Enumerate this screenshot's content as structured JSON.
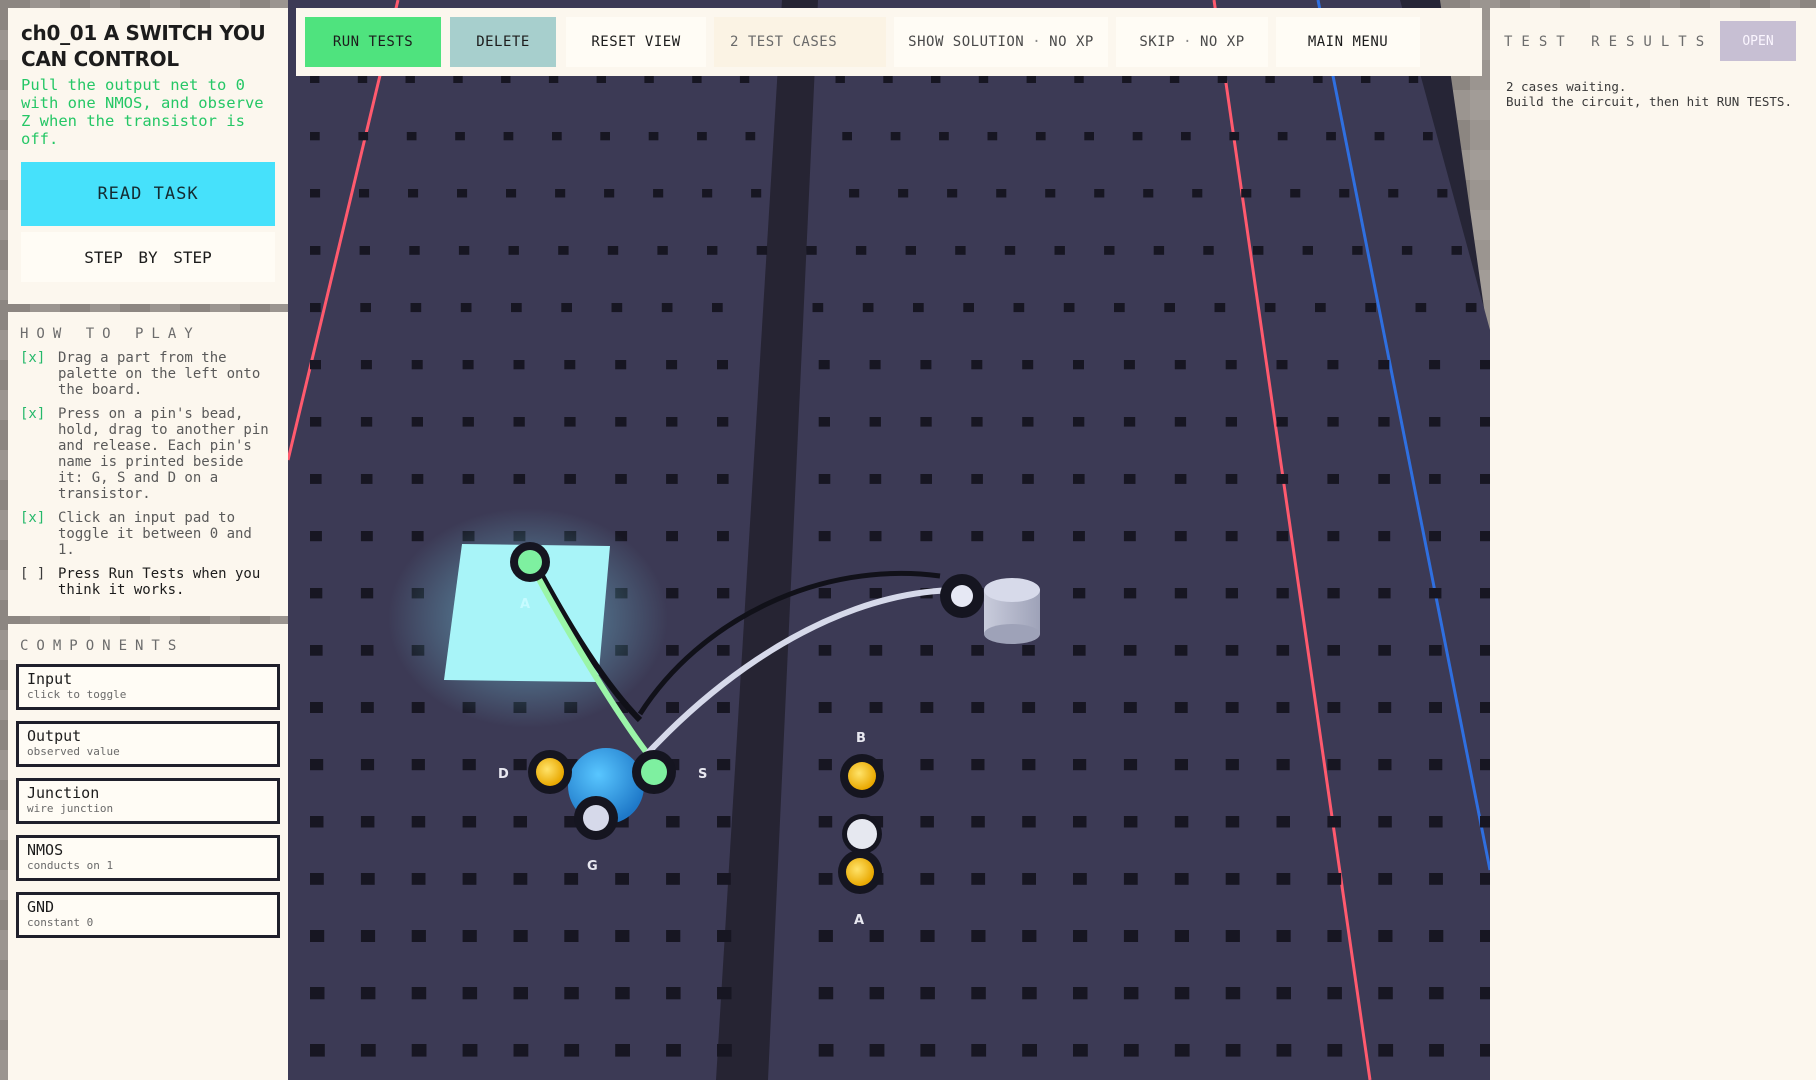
{
  "task": {
    "title": "ch0_01  A SWITCH YOU CAN CONTROL",
    "description": "Pull the output net to 0 with one NMOS, and observe Z when the transistor is off.",
    "read_task_label": "READ TASK",
    "step_by_step_label": "STEP  BY  STEP"
  },
  "how_to_play": {
    "title": "HOW TO PLAY",
    "items": [
      {
        "box": "[x]",
        "text": "Drag a part from the palette on the left onto the board."
      },
      {
        "box": "[x]",
        "text": "Press on a pin's bead, hold, drag to another pin and release. Each pin's name is printed beside it: G, S and D on a transistor."
      },
      {
        "box": "[x]",
        "text": "Click an input pad to toggle it between 0 and 1."
      },
      {
        "box": "[ ]",
        "text": "Press Run Tests when you think it works."
      }
    ]
  },
  "components": {
    "title": "COMPONENTS",
    "items": [
      {
        "name": "Input",
        "sub": "click to toggle"
      },
      {
        "name": "Output",
        "sub": "observed value"
      },
      {
        "name": "Junction",
        "sub": "wire junction"
      },
      {
        "name": "NMOS",
        "sub": "conducts on 1"
      },
      {
        "name": "GND",
        "sub": "constant 0"
      }
    ]
  },
  "toolbar": {
    "run_tests": "RUN TESTS",
    "delete": "DELETE",
    "reset_view": "RESET VIEW",
    "test_cases": "2 TEST CASES",
    "show_solution": "SHOW SOLUTION",
    "show_solution_cost": "NO XP",
    "skip": "SKIP",
    "skip_cost": "NO XP",
    "main_menu": "MAIN MENU",
    "separator": "·"
  },
  "results": {
    "title": "TEST RESULTS",
    "open_label": "OPEN",
    "line1": "2 cases waiting.",
    "line2": "Build the circuit, then hit RUN TESTS."
  },
  "board": {
    "pin_labels": {
      "d": "D",
      "s": "S",
      "g": "G",
      "b": "B",
      "a": "A"
    },
    "colors": {
      "board": "#3c3a55",
      "rail_red": "#ff5a6e",
      "rail_blue": "#2f6fe0",
      "input_pad": "#a8f4f8",
      "bead_yellow": "#f8c21c",
      "bead_green": "#7ef0a0",
      "wire_white": "#d6d9ea",
      "wire_green": "#9af5a8"
    }
  }
}
